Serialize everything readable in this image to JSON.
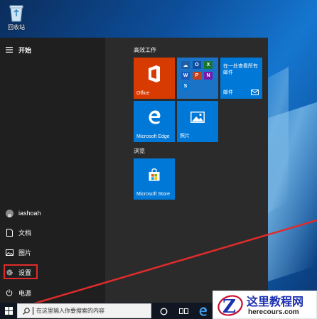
{
  "desktop": {
    "recycle_bin_label": "回收站",
    "recycle_bin_icon": "recycle-bin-icon"
  },
  "start_menu": {
    "header_label": "开始",
    "rail": {
      "user": "iashoah",
      "documents": "文档",
      "pictures": "图片",
      "settings": "设置",
      "power": "电源"
    },
    "highlighted_item": "设置",
    "highlight_color": "#e02b2b",
    "groups": {
      "productivity": "高效工作",
      "browse": "浏览"
    },
    "tiles": {
      "office": "Office",
      "mail_headline": "在一处查看所有邮件",
      "mail": "邮件",
      "edge": "Microsoft Edge",
      "photos": "照片",
      "store": "Microsoft Store"
    },
    "tile_colors": {
      "office": "#d83b01",
      "blue": "#0078d7"
    }
  },
  "taskbar": {
    "search_placeholder": "在这里输入你要搜索的内容",
    "icons": [
      "windows-logo-icon",
      "search-icon",
      "cortana-icon",
      "task-view-icon",
      "edge-icon"
    ]
  },
  "watermark": {
    "title": "这里教程网",
    "url": "herecours.com"
  }
}
